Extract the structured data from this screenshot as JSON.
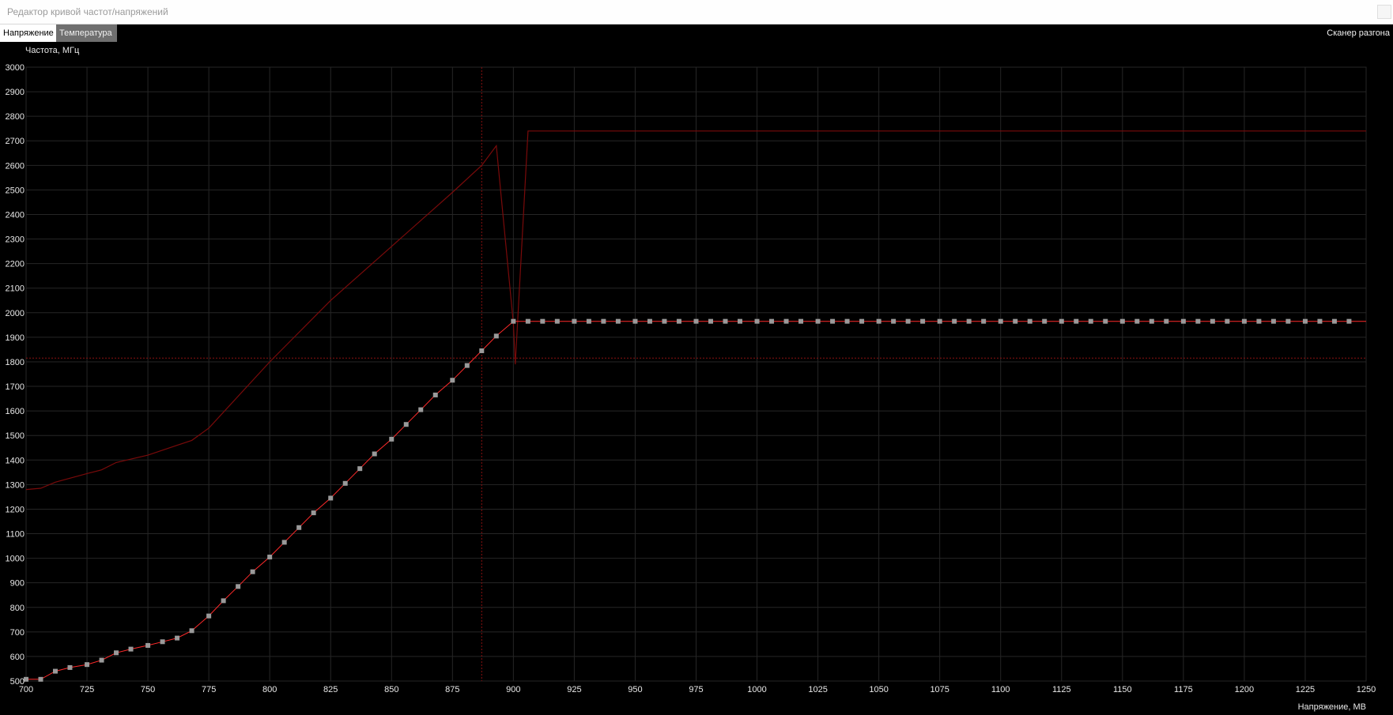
{
  "window": {
    "title": "Редактор кривой частот/напряжений"
  },
  "toolbar": {
    "tabs": [
      {
        "label": "Напряжение",
        "active": true
      },
      {
        "label": "Температура",
        "active": false
      }
    ],
    "scanner_label": "Сканер разгона"
  },
  "colors": {
    "background": "#000000",
    "grid": "#262626",
    "curve": "#ff2a2a",
    "marker": "#9a9a9a",
    "monitor_line": "#7a0a0a",
    "cursor_line": "#8a1010"
  },
  "chart_data": {
    "type": "line",
    "ylabel": "Частота, МГц",
    "xlabel": "Напряжение, МВ",
    "xlim": [
      700,
      1250
    ],
    "ylim": [
      500,
      3000
    ],
    "grid": true,
    "x_ticks": [
      700,
      725,
      750,
      775,
      800,
      825,
      850,
      875,
      900,
      925,
      950,
      975,
      1000,
      1025,
      1050,
      1075,
      1100,
      1125,
      1150,
      1175,
      1200,
      1225,
      1250
    ],
    "y_ticks": [
      500,
      600,
      700,
      800,
      900,
      1000,
      1100,
      1200,
      1300,
      1400,
      1500,
      1600,
      1700,
      1800,
      1900,
      2000,
      2100,
      2200,
      2300,
      2400,
      2500,
      2600,
      2700,
      2800,
      2900,
      3000
    ],
    "cursor_voltage": 887,
    "reference_frequency": 1815,
    "series": [
      {
        "role": "vf-curve",
        "x": [
          700,
          706,
          712,
          718,
          725,
          731,
          737,
          743,
          750,
          756,
          762,
          768,
          775,
          781,
          787,
          793,
          800,
          806,
          812,
          818,
          825,
          831,
          837,
          843,
          850,
          856,
          862,
          868,
          875,
          881,
          887,
          893,
          900,
          906,
          912,
          918,
          925,
          931,
          937,
          943,
          950,
          956,
          962,
          968,
          975,
          981,
          987,
          993,
          1000,
          1006,
          1012,
          1018,
          1025,
          1031,
          1037,
          1043,
          1050,
          1056,
          1062,
          1068,
          1075,
          1081,
          1087,
          1093,
          1100,
          1106,
          1112,
          1118,
          1125,
          1131,
          1137,
          1143,
          1150,
          1156,
          1162,
          1168,
          1175,
          1181,
          1187,
          1193,
          1200,
          1206,
          1212,
          1218,
          1225,
          1231,
          1237,
          1243
        ],
        "y": [
          507,
          507,
          540,
          555,
          567,
          585,
          615,
          630,
          645,
          660,
          675,
          705,
          765,
          827,
          885,
          945,
          1005,
          1065,
          1125,
          1185,
          1245,
          1305,
          1365,
          1425,
          1485,
          1545,
          1605,
          1665,
          1725,
          1785,
          1845,
          1905,
          1965,
          1965,
          1965,
          1965,
          1965,
          1965,
          1965,
          1965,
          1965,
          1965,
          1965,
          1965,
          1965,
          1965,
          1965,
          1965,
          1965,
          1965,
          1965,
          1965,
          1965,
          1965,
          1965,
          1965,
          1965,
          1965,
          1965,
          1965,
          1965,
          1965,
          1965,
          1965,
          1965,
          1965,
          1965,
          1965,
          1965,
          1965,
          1965,
          1965,
          1965,
          1965,
          1965,
          1965,
          1965,
          1965,
          1965,
          1965,
          1965,
          1965,
          1965,
          1965,
          1965,
          1965,
          1965,
          1965
        ]
      },
      {
        "role": "monitor-trace",
        "x": [
          700,
          706,
          712,
          725,
          731,
          737,
          750,
          762,
          768,
          775,
          800,
          825,
          850,
          875,
          887,
          893,
          900,
          900.8,
          906,
          1250
        ],
        "y": [
          1280,
          1285,
          1310,
          1345,
          1360,
          1390,
          1420,
          1460,
          1480,
          1530,
          1800,
          2050,
          2270,
          2490,
          2600,
          2680,
          1955,
          1790,
          2740,
          2740
        ]
      }
    ]
  }
}
